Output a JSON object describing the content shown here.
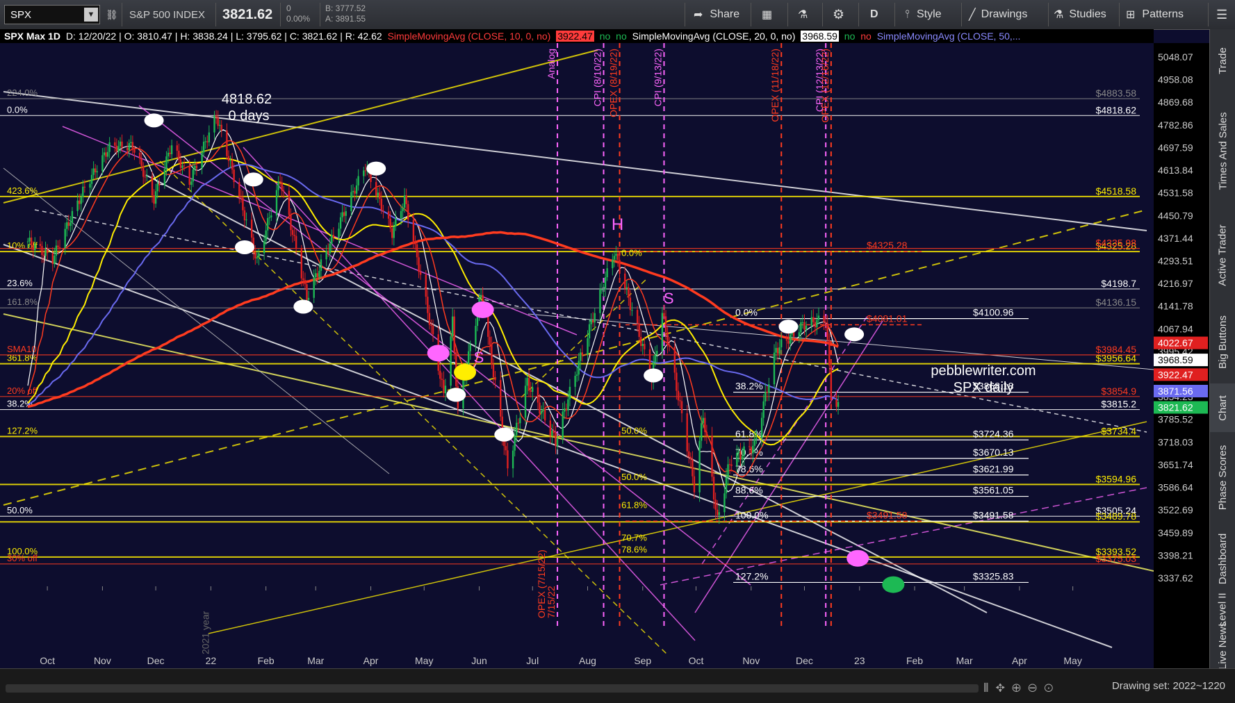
{
  "toolbar": {
    "symbol": "SPX",
    "description": "S&P 500 INDEX",
    "last": "3821.62",
    "change": "0",
    "change_pct": "0.00%",
    "bid": "B: 3777.52",
    "ask": "A: 3891.55",
    "share": "Share",
    "period": "D",
    "style": "Style",
    "drawings": "Drawings",
    "studies": "Studies",
    "patterns": "Patterns"
  },
  "infobar": {
    "title": "SPX Max 1D",
    "ohlc": "D: 12/20/22 | O: 3810.47 | H: 3838.24 | L: 3795.62 | C: 3821.62 | R: 42.62",
    "sma10": "SimpleMovingAvg (CLOSE, 10, 0, no)",
    "sma10_val": "3922.47",
    "sma20": "SimpleMovingAvg (CLOSE, 20, 0, no)",
    "sma20_val": "3968.59",
    "sma50": "SimpleMovingAvg (CLOSE, 50,...",
    "flag_no": "no"
  },
  "right_tabs": [
    "Trade",
    "Times And Sales",
    "Active Trader",
    "Big Buttons",
    "Chart",
    "Phase Scores",
    "Dashboard",
    "Level II",
    "Live News"
  ],
  "bottom": {
    "drawing_set": "Drawing set: 2022~1220"
  },
  "colors": {
    "bg": "#0d0d2e",
    "up": "#1db954",
    "down": "#e02020",
    "sma_red": "#ff3b1f",
    "sma_yellow": "#ffee00",
    "sma_blue": "#6a6af0",
    "magenta": "#ff66ff",
    "fib": "#ffff00"
  },
  "chart_data": {
    "type": "candlestick",
    "symbol": "SPX",
    "watermark_1": "pebblewriter.com",
    "watermark_2": "SPX daily",
    "peak_label": "4818.62",
    "peak_days": "0 days",
    "x_tick_labels": [
      "Oct",
      "Nov",
      "Dec",
      "22",
      "Feb",
      "Mar",
      "Apr",
      "May",
      "Jun",
      "Jul",
      "Aug",
      "Sep",
      "Oct",
      "Nov",
      "Dec",
      "23",
      "Feb",
      "Mar",
      "Apr",
      "May"
    ],
    "y_ticks": [
      5048.07,
      4958.08,
      4869.68,
      4782.86,
      4697.59,
      4613.84,
      4531.58,
      4450.79,
      4371.44,
      4293.51,
      4216.97,
      4141.78,
      4067.94,
      3995.42,
      3928.09,
      3854.23,
      3785.52,
      3718.03,
      3651.74,
      3586.64,
      3522.69,
      3459.89,
      3398.21,
      3337.62
    ],
    "price_flags": [
      {
        "value": "4022.67",
        "price": 4022.67,
        "color": "#e02020"
      },
      {
        "value": "3968.59",
        "price": 3968.59,
        "color": "#ffffff"
      },
      {
        "value": "3922.47",
        "price": 3922.47,
        "color": "#e02020"
      },
      {
        "value": "3871.56",
        "price": 3871.56,
        "color": "#6a6af0"
      },
      {
        "value": "3821.62",
        "price": 3821.62,
        "color": "#1db954"
      }
    ],
    "horizontal_levels": [
      {
        "price": 4818.62,
        "label": "$4818.62",
        "color": "#ffffff",
        "left_label": "0.0%"
      },
      {
        "price": 4883.58,
        "label": "$4883.58",
        "color": "#888888",
        "left_label": "224.0%"
      },
      {
        "price": 4518.58,
        "label": "$4518.58",
        "color": "#ffee00",
        "left_label": "423.6%"
      },
      {
        "price": 4325.28,
        "label": "$4325.28",
        "color": "#ffee00",
        "left_label": "10% off"
      },
      {
        "price": 4198.7,
        "label": "$4198.7",
        "color": "#ffffff",
        "left_label": "23.6%"
      },
      {
        "price": 4136.15,
        "label": "$4136.15",
        "color": "#888888",
        "left_label": "161.8%"
      },
      {
        "price": 3956.64,
        "label": "$3956.64",
        "color": "#ffee00",
        "left_label": "361.8%"
      },
      {
        "price": 3984.45,
        "label": "$3984.45",
        "color": "#ff3b1f",
        "left_label": "SMA10"
      },
      {
        "price": 3854.9,
        "label": "$3854.9",
        "color": "#ff3b1f",
        "left_label": "20% off"
      },
      {
        "price": 3815.2,
        "label": "$3815.2",
        "color": "#ffffff",
        "left_label": "38.2%"
      },
      {
        "price": 3734.4,
        "label": "$3734.4",
        "color": "#ffee00",
        "left_label": "127.2%"
      },
      {
        "price": 3594.96,
        "label": "$3594.96",
        "color": "#ffee00",
        "left_label": ""
      },
      {
        "price": 3505.24,
        "label": "$3505.24",
        "color": "#ffffff",
        "left_label": "50.0%"
      },
      {
        "price": 3489.78,
        "label": "$3489.78",
        "color": "#ffee00",
        "left_label": ""
      },
      {
        "price": 3393.52,
        "label": "$3393.52",
        "color": "#ffee00",
        "left_label": "100.0%"
      },
      {
        "price": 3375.03,
        "label": "$3375.03",
        "color": "#ff3b1f",
        "left_label": "30% off"
      },
      {
        "price": 4335.98,
        "label": "$4335.98",
        "color": "#ff3b1f",
        "left_label": ""
      }
    ],
    "mid_levels": [
      {
        "price": 4100.96,
        "label": "$4100.96",
        "fib": "0.0%"
      },
      {
        "price": 3868.18,
        "label": "$3868.18",
        "fib": "38.2%"
      },
      {
        "price": 3724.36,
        "label": "$3724.36",
        "fib": "61.8%"
      },
      {
        "price": 3670.13,
        "label": "$3670.13",
        "fib": "70.7%"
      },
      {
        "price": 3621.99,
        "label": "$3621.99",
        "fib": "78.6%"
      },
      {
        "price": 3561.05,
        "label": "$3561.05",
        "fib": "88.6%"
      },
      {
        "price": 3491.58,
        "label": "$3491.58",
        "fib": "100.0%"
      },
      {
        "price": 3325.83,
        "label": "$3325.83",
        "fib": "127.2%"
      }
    ],
    "red_levels": [
      {
        "price": 4325.28,
        "label": "$4325.28"
      },
      {
        "price": 4081.01,
        "label": "$4081.01"
      },
      {
        "price": 3491.58,
        "label": "$3491.58"
      }
    ],
    "event_lines": [
      {
        "label": "Analog",
        "color": "#ff66ff",
        "date": "2022-07-15"
      },
      {
        "label": "CPI (8/10/22)",
        "color": "#ff66ff",
        "date": "2022-08-10"
      },
      {
        "label": "OPEX (8/19/22)",
        "color": "#ff3b1f",
        "date": "2022-08-19"
      },
      {
        "label": "CPI (9/13/22)",
        "color": "#ff66ff",
        "date": "2022-09-13"
      },
      {
        "label": "OPEX (11/18/22)",
        "color": "#ff3b1f",
        "date": "2022-11-18"
      },
      {
        "label": "CPI (12/13/22)",
        "color": "#ff66ff",
        "date": "2022-12-13"
      },
      {
        "label": "OPEX (12/16/22)",
        "color": "#ff3b1f",
        "date": "2022-12-16"
      }
    ],
    "bottom_event_labels": [
      "OPEX (7/15/22)",
      "7/15/22"
    ],
    "year_label": "2021 year",
    "fib_labels_left": [
      "50.0%",
      "61.8%",
      "70.7%",
      "78.6%"
    ],
    "pattern_labels": [
      "H",
      "S",
      "S",
      "0.0%",
      "50.0%"
    ],
    "sma_last": {
      "sma10": 3922.47,
      "sma20": 3968.59,
      "sma50": 3871.56,
      "sma200": 4022.67
    }
  }
}
